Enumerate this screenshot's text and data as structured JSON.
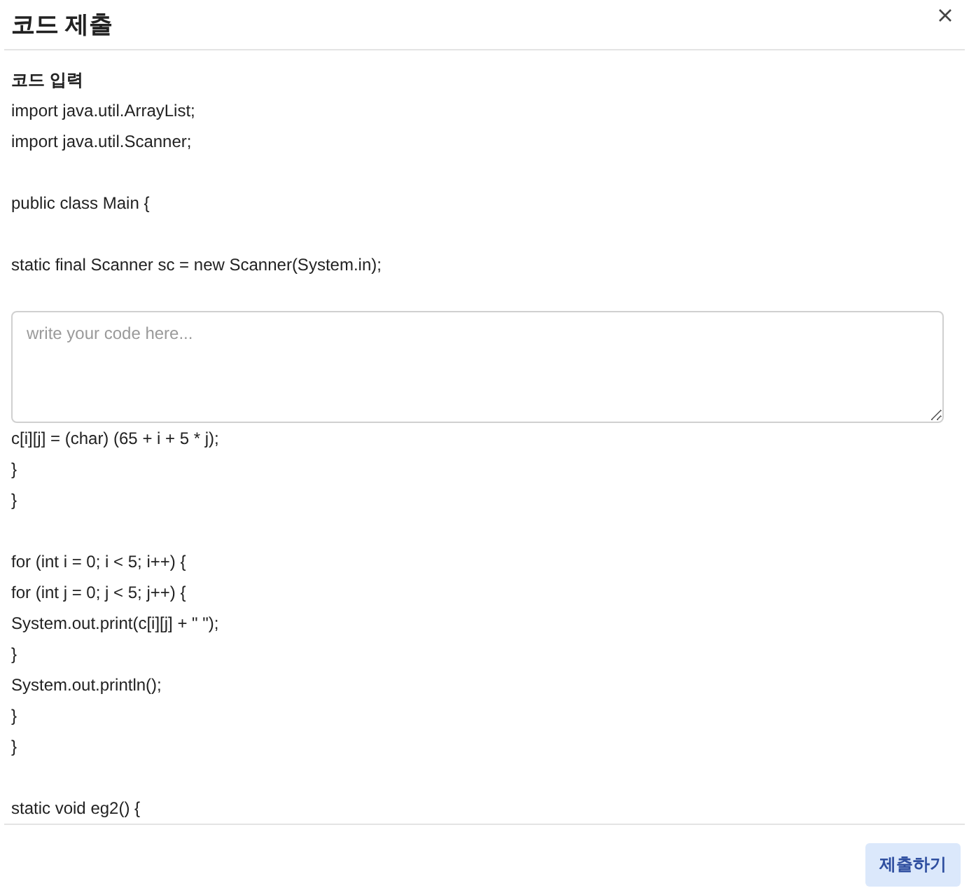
{
  "dialog": {
    "title": "코드 제출"
  },
  "code_label": "코드 입력",
  "code_before": [
    [
      "import java.util.ArrayList;",
      "import java.util.Scanner;"
    ],
    [
      "public class Main {"
    ],
    [
      "static final Scanner sc = new Scanner(System.in);"
    ]
  ],
  "code_input": {
    "placeholder": "write your code here..."
  },
  "code_after": [
    [
      "c[i][j] = (char) (65 + i + 5 * j);",
      "}",
      "}"
    ],
    [
      "for (int i = 0; i < 5; i++) {",
      "for (int j = 0; j < 5; j++) {",
      "System.out.print(c[i][j] + \" \");",
      "}",
      "System.out.println();",
      "}",
      "}"
    ],
    [
      "static void eg2() {"
    ]
  ],
  "submit_button": "제출하기"
}
